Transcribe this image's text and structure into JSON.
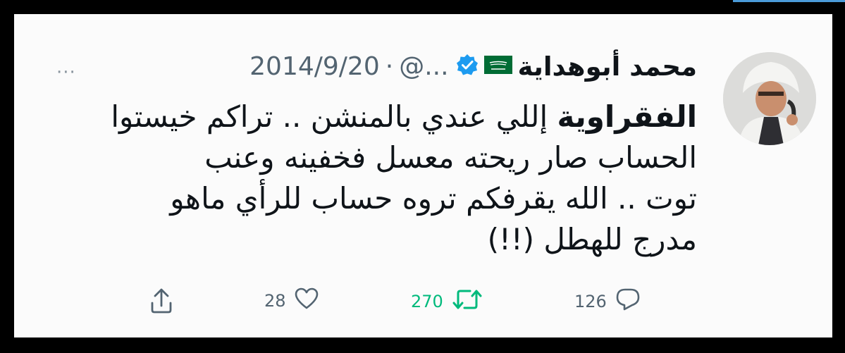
{
  "tweet": {
    "author_name": "محمد أبوهداية",
    "handle": "@...",
    "separator": "·",
    "date": "2014/9/20",
    "more_label": "···",
    "body_lines": [
      {
        "bold": "الفقراوية",
        "text": " إللي عندي بالمنشن .. تراكم خيستوا"
      },
      {
        "bold": "",
        "text": "الحساب صار ريحته معسل فخفينه وعنب"
      },
      {
        "bold": "",
        "text": "توت .. الله يقرفكم تروه حساب للرأي ماهو"
      },
      {
        "bold": "",
        "text": "مدرج للهطل (!!)"
      }
    ],
    "actions": {
      "reply": {
        "icon": "reply-icon",
        "count": "126"
      },
      "retweet": {
        "icon": "retweet-icon",
        "count": "270",
        "color": "#00ba7c"
      },
      "like": {
        "icon": "heart-icon",
        "count": "28"
      },
      "share": {
        "icon": "share-icon"
      }
    },
    "colors": {
      "text": "#0f1419",
      "muted": "#536471",
      "verified": "#1d9bf0",
      "flag": "#006c35"
    }
  }
}
